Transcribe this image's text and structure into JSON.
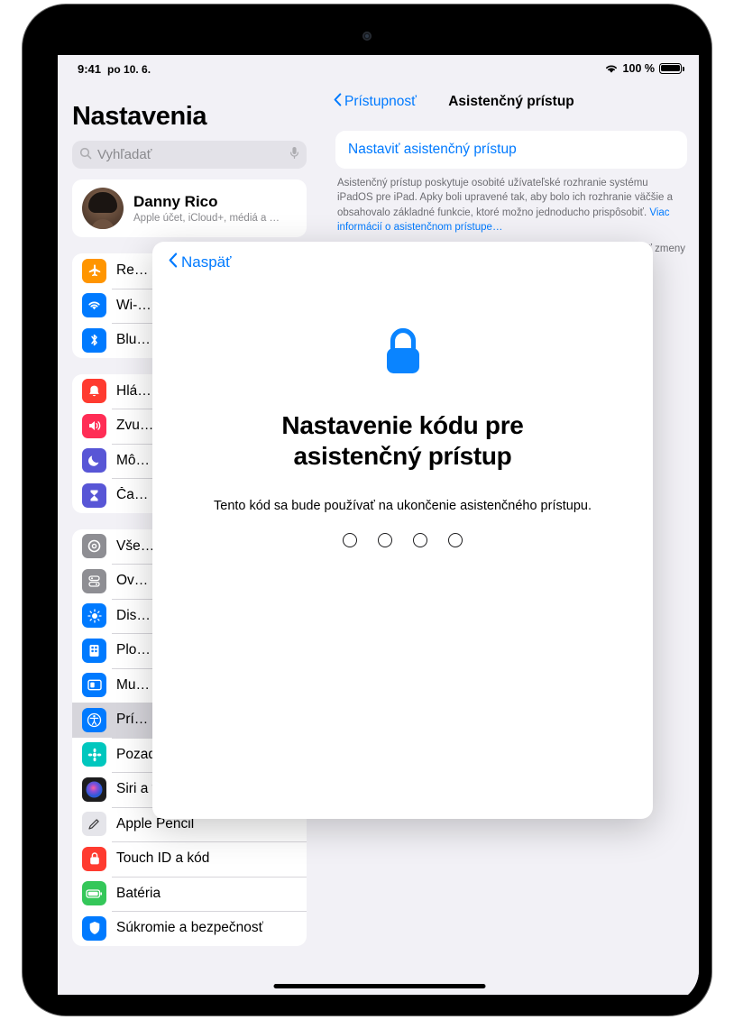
{
  "status": {
    "time": "9:41",
    "date": "po 10. 6.",
    "wifi_icon": "wifi-icon",
    "battery_percent": "100 %"
  },
  "sidebar": {
    "title": "Nastavenia",
    "search": {
      "placeholder": "Vyhľadať",
      "icon": "search-icon",
      "mic_icon": "microphone-icon"
    },
    "account": {
      "name": "Danny Rico",
      "subtitle": "Apple účet, iCloud+, médiá a …"
    },
    "groups": [
      {
        "items": [
          {
            "label": "Re…",
            "full_label": "Režim Lietadlo",
            "icon": "airplane-icon",
            "color": "#ff9500"
          },
          {
            "label": "Wi-…",
            "full_label": "Wi-Fi",
            "icon": "wifi-icon",
            "color": "#007aff"
          },
          {
            "label": "Blu…",
            "full_label": "Bluetooth",
            "icon": "bluetooth-icon",
            "color": "#007aff"
          }
        ]
      },
      {
        "items": [
          {
            "label": "Hlá…",
            "full_label": "Hlásenia",
            "icon": "notifications-icon",
            "color": "#ff3b30"
          },
          {
            "label": "Zvu…",
            "full_label": "Zvuky",
            "icon": "sounds-icon",
            "color": "#ff2d55"
          },
          {
            "label": "Mô…",
            "full_label": "Môj čas",
            "icon": "focus-icon",
            "color": "#5856d6"
          },
          {
            "label": "Ča…",
            "full_label": "Čas pred obrazovkou",
            "icon": "screen-time-icon",
            "color": "#5856d6"
          }
        ]
      },
      {
        "items": [
          {
            "label": "Vše…",
            "full_label": "Všeobecné",
            "icon": "gear-icon",
            "color": "#8e8e93"
          },
          {
            "label": "Ov…",
            "full_label": "Ovládacie centrum",
            "icon": "control-center-icon",
            "color": "#8e8e93"
          },
          {
            "label": "Dis…",
            "full_label": "Displej a jas",
            "icon": "brightness-icon",
            "color": "#007aff"
          },
          {
            "label": "Plo…",
            "full_label": "Plocha a Dock",
            "icon": "home-screen-icon",
            "color": "#007aff"
          },
          {
            "label": "Mu…",
            "full_label": "Multitasking a gestá",
            "icon": "multitasking-icon",
            "color": "#007aff"
          },
          {
            "label": "Prí…",
            "full_label": "Prístupnosť",
            "icon": "accessibility-icon",
            "color": "#007aff",
            "selected": true
          },
          {
            "label": "Pozadie",
            "full_label": "Pozadie",
            "icon": "wallpaper-icon",
            "color": "#00c7be"
          },
          {
            "label": "Siri a vyhľadávanie",
            "full_label": "Siri a vyhľadávanie",
            "icon": "siri-icon",
            "color": "#1c1c1e"
          },
          {
            "label": "Apple Pencil",
            "full_label": "Apple Pencil",
            "icon": "pencil-icon",
            "color": "#8e8e93"
          },
          {
            "label": "Touch ID a kód",
            "full_label": "Touch ID a kód",
            "icon": "touch-id-icon",
            "color": "#ff3b30"
          },
          {
            "label": "Batéria",
            "full_label": "Batéria",
            "icon": "battery-icon",
            "color": "#34c759"
          },
          {
            "label": "Súkromie a bezpečnosť",
            "full_label": "Súkromie a bezpečnosť",
            "icon": "privacy-icon",
            "color": "#007aff"
          }
        ]
      }
    ]
  },
  "detail": {
    "back_label": "Prístupnosť",
    "title": "Asistenčný prístup",
    "setup_label": "Nastaviť asistenčný prístup",
    "description": "Asistenčný prístup poskytuje osobité užívateľské rozhranie systému iPadOS pre iPad. Apky boli upravené tak, aby bolo ich rozhranie väčšie a obsahovalo základné funkcie, ktoré možno jednoducho prispôsobiť.",
    "learn_more": "Viac informácií o asistenčnom prístupe…",
    "note": "nať zmeny"
  },
  "modal": {
    "back_label": "Naspäť",
    "lock_icon": "lock-icon",
    "lock_color": "#0a84ff",
    "title_line1": "Nastavenie kódu pre",
    "title_line2": "asistenčný prístup",
    "subtitle": "Tento kód sa bude používať na ukončenie asistenčného prístupu.",
    "code_length": 4
  },
  "colors": {
    "accent": "#007aff",
    "background": "#f2f1f6",
    "card": "#ffffff"
  }
}
